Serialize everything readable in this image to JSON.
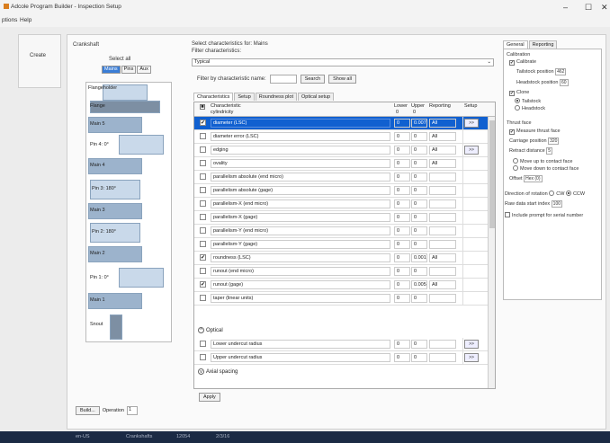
{
  "window": {
    "title": "Adcole Program Builder - Inspection Setup",
    "minimize": "–",
    "maximize": "☐",
    "close": "✕"
  },
  "menu": {
    "items": [
      "ptions",
      "Help"
    ]
  },
  "leftbar": {
    "create_label": "Create"
  },
  "crank": {
    "name_label": "Crankshaft",
    "select_all_label": "Select all",
    "buttons": [
      "Mains",
      "Pins",
      "Aux"
    ],
    "segment_labels": [
      "Flangeholder",
      "Flange",
      "Main 5",
      "Pin 4: 0°",
      "Main 4",
      "Pin 3: 180°",
      "Main 3",
      "Pin 2: 180°",
      "Main 2",
      "Pin 1: 0°",
      "Main 1",
      "Snout"
    ]
  },
  "characteristics": {
    "select_label": "Select characteristics for: Mains",
    "filter_label": "Filter characteristics:",
    "filter_value": "Typical",
    "filter_by_name_label": "Filter by characteristic name:",
    "search_label": "Search",
    "show_all_label": "Show all",
    "tabs": [
      "Characteristics",
      "Setup",
      "Roundness plot",
      "Optical setup"
    ],
    "columns": [
      "Characteristic",
      "Lower",
      "Upper",
      "Reporting",
      "Setup"
    ],
    "top_row": {
      "name": "cylindricity",
      "lower": "0",
      "upper": "0"
    },
    "rows": [
      {
        "checked": "✔",
        "name": "diameter (LSC)",
        "lower": "0",
        "upper": "0.007",
        "rep": "All",
        "setup": ">>"
      },
      {
        "checked": "",
        "name": "diameter error (LSC)",
        "lower": "0",
        "upper": "0",
        "rep": "All",
        "setup": ""
      },
      {
        "checked": "",
        "name": "edging",
        "lower": "0",
        "upper": "0",
        "rep": "All",
        "setup": ">>"
      },
      {
        "checked": "",
        "name": "ovality",
        "lower": "0",
        "upper": "0",
        "rep": "All",
        "setup": ""
      },
      {
        "checked": "",
        "name": "parallelism absolute (end micro)",
        "lower": "0",
        "upper": "0",
        "rep": "",
        "setup": ""
      },
      {
        "checked": "",
        "name": "parallelism absolute (gage)",
        "lower": "0",
        "upper": "0",
        "rep": "",
        "setup": ""
      },
      {
        "checked": "",
        "name": "parallelism-X (end micro)",
        "lower": "0",
        "upper": "0",
        "rep": "",
        "setup": ""
      },
      {
        "checked": "",
        "name": "parallelism-X (gage)",
        "lower": "0",
        "upper": "0",
        "rep": "",
        "setup": ""
      },
      {
        "checked": "",
        "name": "parallelism-Y (end micro)",
        "lower": "0",
        "upper": "0",
        "rep": "",
        "setup": ""
      },
      {
        "checked": "",
        "name": "parallelism-Y (gage)",
        "lower": "0",
        "upper": "0",
        "rep": "",
        "setup": ""
      },
      {
        "checked": "✔",
        "name": "roundness (LSC)",
        "lower": "0",
        "upper": "0.001",
        "rep": "All",
        "setup": ""
      },
      {
        "checked": "",
        "name": "runout (end micro)",
        "lower": "0",
        "upper": "0",
        "rep": "",
        "setup": ""
      },
      {
        "checked": "✔",
        "name": "runout (gage)",
        "lower": "0",
        "upper": "0.005",
        "rep": "All",
        "setup": ""
      },
      {
        "checked": "",
        "name": "taper (linear units)",
        "lower": "0",
        "upper": "0",
        "rep": "",
        "setup": ""
      }
    ],
    "optical_group": "Optical",
    "optical_rows": [
      {
        "checked": "",
        "name": "Lower undercut radius",
        "lower": "0",
        "upper": "0",
        "rep": "",
        "setup": ">>"
      },
      {
        "checked": "",
        "name": "Upper undercut radius",
        "lower": "0",
        "upper": "0",
        "rep": "",
        "setup": ">>"
      }
    ],
    "axial_group": "Axial spacing",
    "apply_label": "Apply"
  },
  "right": {
    "tabs": [
      "General",
      "Reporting"
    ],
    "calibration_label": "Calibration",
    "calibrate_label": "Calibrate",
    "tailstock_pos_label": "Tailstock position",
    "tailstock_pos_value": "462",
    "headstock_pos_label": "Headstock position",
    "headstock_pos_value": "60",
    "clone_label": "Clone",
    "tailstock_label": "Tailstock",
    "headstock_label": "Headstock",
    "thrust_label": "Thrust face",
    "measure_thrust_label": "Measure thrust face",
    "carriage_pos_label": "Carriage position",
    "carriage_pos_value": "320",
    "retract_label": "Retract distance",
    "retract_value": "5",
    "move_up_label": "Move up to contact face",
    "move_down_label": "Move down to contact face",
    "offset_label": "Offset",
    "offset_value": "Hex (0)",
    "rotation_label": "Direction of rotation",
    "cw_label": "CW",
    "ccw_label": "CCW",
    "raw_data_label": "Raw data start index",
    "raw_data_value": "100",
    "prompt_label": "Include prompt for serial number"
  },
  "bottom": {
    "build_label": "Build...",
    "operation_label": "Operation",
    "operation_value": "1"
  },
  "status": {
    "items": [
      "en-US",
      "Crankshafts",
      "12054",
      "2/3/16"
    ]
  }
}
